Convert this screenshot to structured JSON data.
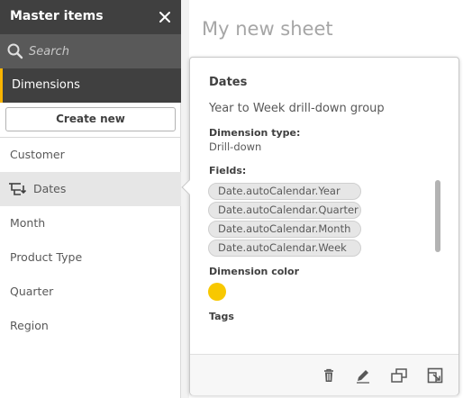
{
  "panel": {
    "title": "Master items",
    "search_placeholder": "Search",
    "category": "Dimensions",
    "create_label": "Create new",
    "accent_color": "#f8b400",
    "items": [
      {
        "label": "Customer",
        "icon": null
      },
      {
        "label": "Dates",
        "icon": "drill-down-icon",
        "selected": true
      },
      {
        "label": "Month",
        "icon": null
      },
      {
        "label": "Product Type",
        "icon": null
      },
      {
        "label": "Quarter",
        "icon": null
      },
      {
        "label": "Region",
        "icon": null
      }
    ]
  },
  "sheet": {
    "title": "My new sheet"
  },
  "detail": {
    "title": "Dates",
    "description": "Year to Week drill-down group",
    "type_label": "Dimension type:",
    "type_value": "Drill-down",
    "fields_label": "Fields:",
    "fields": [
      "Date.autoCalendar.Year",
      "Date.autoCalendar.Quarter",
      "Date.autoCalendar.Month",
      "Date.autoCalendar.Week"
    ],
    "color_label": "Dimension color",
    "color_value": "#f8c800",
    "tags_label": "Tags",
    "footer_icons": [
      "trash-icon",
      "edit-icon",
      "duplicate-icon",
      "expand-icon"
    ]
  }
}
